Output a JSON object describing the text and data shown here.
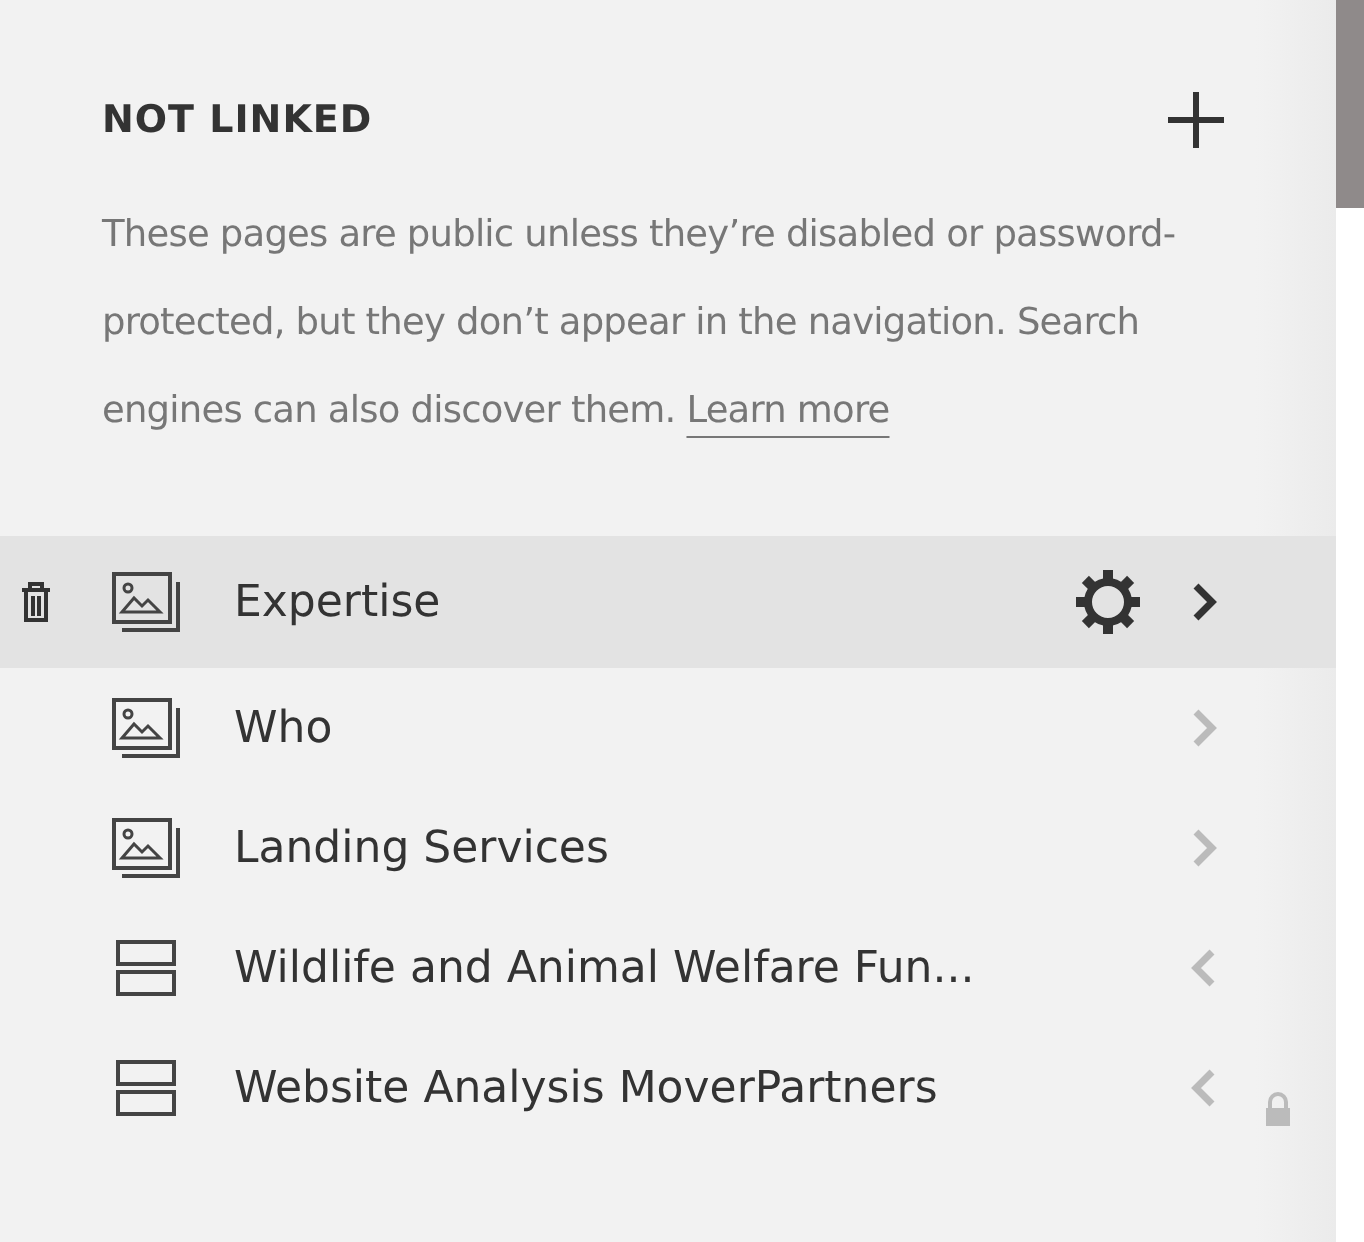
{
  "section": {
    "title": "NOT LINKED",
    "description": "These pages are public unless they’re disabled or password-protected, but they don’t appear in the navigation. Search engines can also discover them.",
    "link": "Learn more"
  },
  "pages": [
    {
      "title": "Expertise",
      "kind": "page",
      "selected": true,
      "locked": false
    },
    {
      "title": "Who",
      "kind": "page",
      "selected": false,
      "locked": false
    },
    {
      "title": "Landing Services",
      "kind": "page",
      "selected": false,
      "locked": false
    },
    {
      "title": "Wildlife and Animal Welfare Fun...",
      "kind": "folder",
      "selected": false,
      "locked": false
    },
    {
      "title": "Website Analysis MoverPartners",
      "kind": "folder",
      "selected": false,
      "locked": true
    }
  ]
}
